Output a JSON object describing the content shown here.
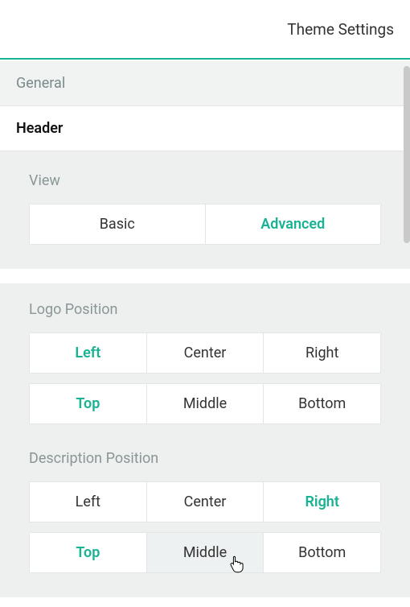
{
  "header": {
    "title": "Theme Settings"
  },
  "tabs": {
    "general": "General",
    "header": "Header"
  },
  "view": {
    "title": "View",
    "options": {
      "basic": "Basic",
      "advanced": "Advanced"
    }
  },
  "logoPosition": {
    "title": "Logo Position",
    "row1": {
      "left": "Left",
      "center": "Center",
      "right": "Right"
    },
    "row2": {
      "top": "Top",
      "middle": "Middle",
      "bottom": "Bottom"
    }
  },
  "descriptionPosition": {
    "title": "Description Position",
    "row1": {
      "left": "Left",
      "center": "Center",
      "right": "Right"
    },
    "row2": {
      "top": "Top",
      "middle": "Middle",
      "bottom": "Bottom"
    }
  }
}
